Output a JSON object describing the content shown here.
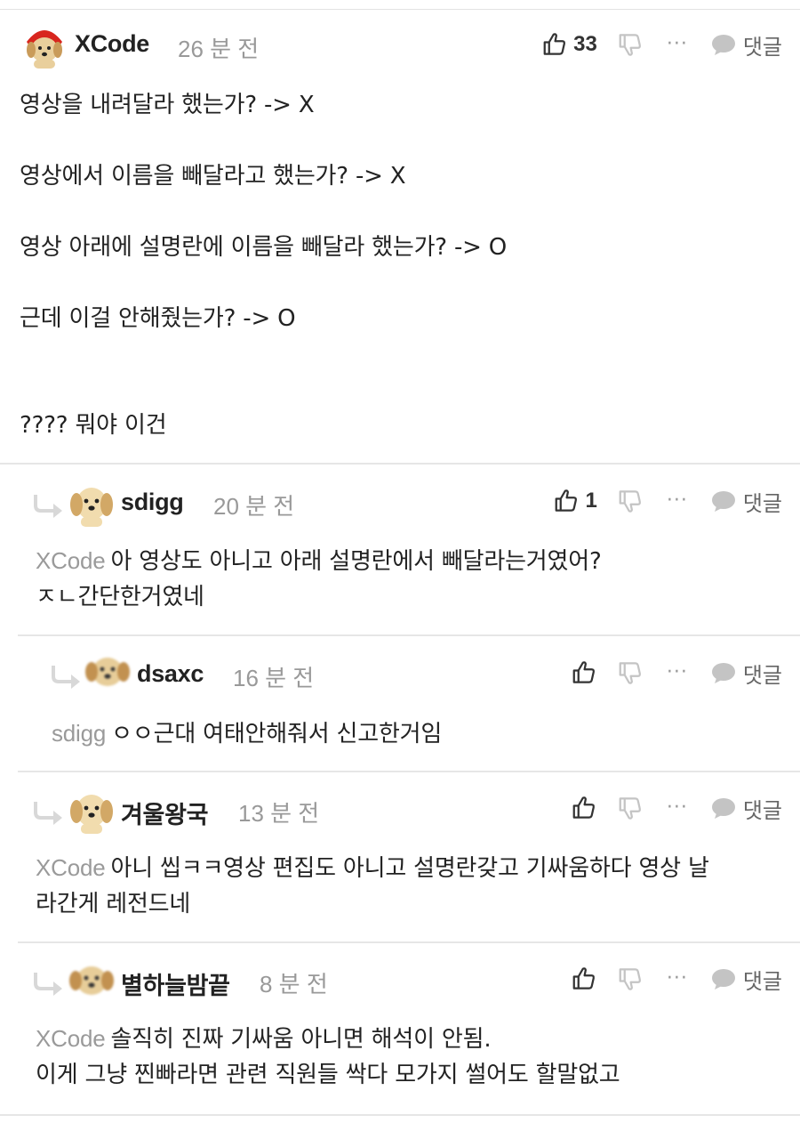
{
  "comments": [
    {
      "nick": "XCode",
      "time": "26 분 전",
      "likes": "33",
      "more": "···",
      "reply_label": "댓글",
      "mention": "",
      "text": "영상을 내려달라 했는가? -> X\n\n영상에서 이름을 빼달라고 했는가? -> X\n\n영상 아래에 설명란에 이름을 빼달라 했는가? -> O\n\n근데 이걸 안해줬는가? -> O\n\n\n???? 뭐야 이건"
    },
    {
      "nick": "sdigg",
      "time": "20 분 전",
      "likes": "1",
      "more": "···",
      "reply_label": "댓글",
      "mention": "XCode",
      "text": "아 영상도 아니고 아래 설명란에서 빼달라는거였어?\nㅈㄴ간단한거였네"
    },
    {
      "nick": "dsaxc",
      "time": "16 분 전",
      "likes": "",
      "more": "···",
      "reply_label": "댓글",
      "mention": "sdigg",
      "text": "ㅇㅇ근대 여태안해줘서 신고한거임"
    },
    {
      "nick": "겨울왕국",
      "time": "13 분 전",
      "likes": "",
      "more": "···",
      "reply_label": "댓글",
      "mention": "XCode",
      "text": "아니 씹ㅋㅋ영상 편집도 아니고 설명란갖고 기싸움하다 영상 날\n라간게 레전드네"
    },
    {
      "nick": "별하늘밤끝",
      "time": "8 분 전",
      "likes": "",
      "more": "···",
      "reply_label": "댓글",
      "mention": "XCode",
      "text": "솔직히 진짜 기싸움 아니면 해석이 안됨.\n이게 그냥 찐빠라면 관련 직원들 싹다 모가지 썰어도 할말없고"
    }
  ],
  "colors": {
    "mention": "#9a9a9a",
    "time": "#999999",
    "icon": "#333333",
    "icon_muted": "#c4c4c4",
    "separator": "#e6e6e6"
  }
}
